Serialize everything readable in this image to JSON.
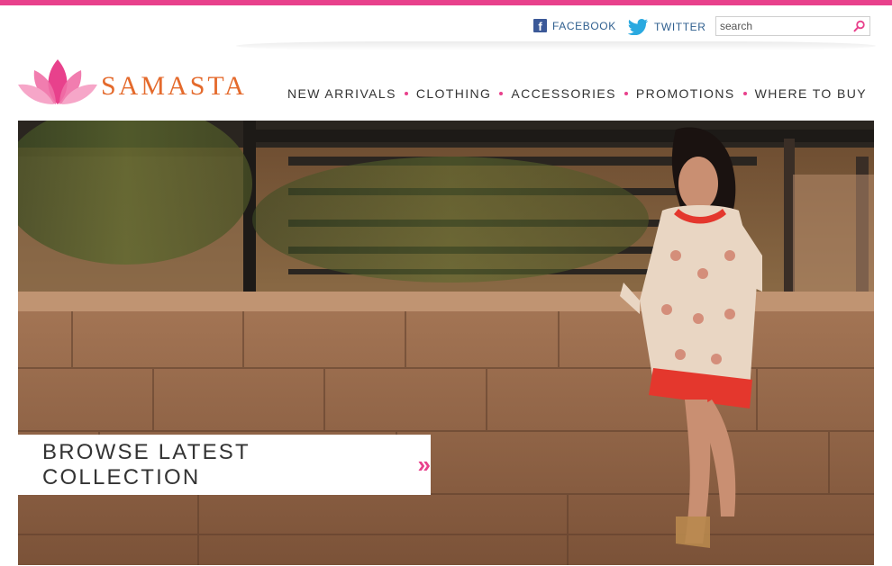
{
  "colors": {
    "accent": "#e8418c",
    "brand_orange": "#e46a2c",
    "facebook_blue": "#3b5998",
    "twitter_blue": "#2aa9e0"
  },
  "social": {
    "facebook": {
      "label": "FACEBOOK",
      "icon": "facebook-icon"
    },
    "twitter": {
      "label": "TWITTER",
      "icon": "twitter-bird-icon"
    }
  },
  "search": {
    "placeholder": "search",
    "value": "",
    "icon": "magnifier-icon"
  },
  "logo": {
    "text": "SAMASTA",
    "icon": "lotus-icon"
  },
  "nav": {
    "items": [
      {
        "label": "NEW ARRIVALS"
      },
      {
        "label": "CLOTHING"
      },
      {
        "label": "ACCESSORIES"
      },
      {
        "label": "PROMOTIONS"
      },
      {
        "label": "WHERE TO BUY"
      }
    ]
  },
  "hero": {
    "cta_label": "BROWSE LATEST COLLECTION",
    "cta_icon": "double-chevron-right-icon"
  }
}
